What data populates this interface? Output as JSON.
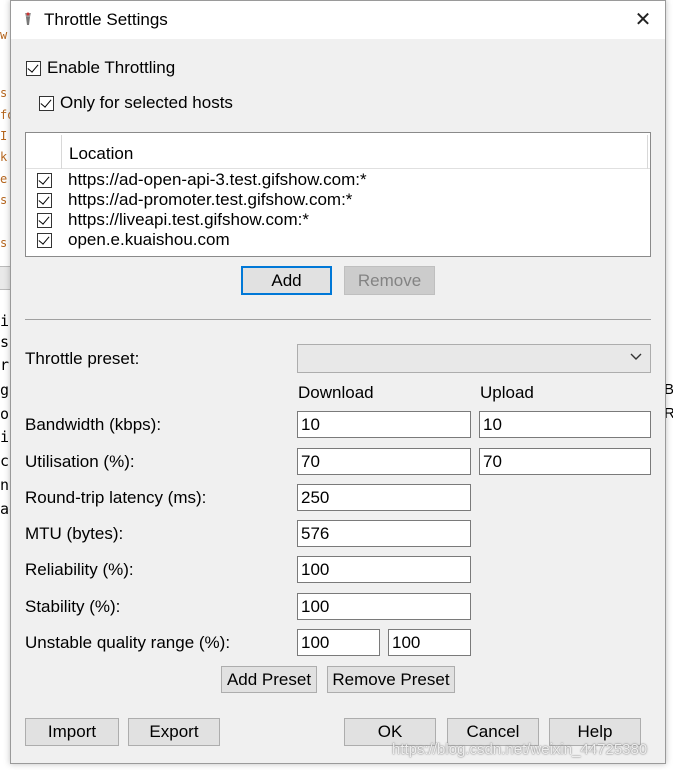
{
  "background": {
    "left_chars": [
      "w",
      "s:",
      "fo",
      "I",
      "k",
      "e",
      "s",
      "s",
      "ic",
      "su",
      "ro",
      "gi",
      "oc",
      "ip",
      "ct",
      "nt",
      "ag"
    ],
    "right_chars": [
      "B",
      "R"
    ]
  },
  "dialog": {
    "title": "Throttle Settings",
    "close_glyph": "✕",
    "enable_throttling": {
      "label": "Enable Throttling",
      "checked": true
    },
    "only_selected_hosts": {
      "label": "Only for selected hosts",
      "checked": true
    },
    "hosts_table": {
      "column_header": "Location",
      "rows": [
        {
          "checked": true,
          "location": "https://ad-open-api-3.test.gifshow.com:*"
        },
        {
          "checked": true,
          "location": "https://ad-promoter.test.gifshow.com:*"
        },
        {
          "checked": true,
          "location": "https://liveapi.test.gifshow.com:*"
        },
        {
          "checked": true,
          "location": "open.e.kuaishou.com"
        }
      ]
    },
    "buttons": {
      "add": "Add",
      "remove": "Remove",
      "add_preset": "Add Preset",
      "remove_preset": "Remove Preset",
      "import": "Import",
      "export": "Export",
      "ok": "OK",
      "cancel": "Cancel",
      "help": "Help"
    },
    "preset": {
      "label": "Throttle preset:",
      "value": "",
      "icon": "chevron-down-icon"
    },
    "columns": {
      "download": "Download",
      "upload": "Upload"
    },
    "fields": {
      "bandwidth": {
        "label": "Bandwidth (kbps):",
        "download": "10",
        "upload": "10"
      },
      "utilisation": {
        "label": "Utilisation (%):",
        "download": "70",
        "upload": "70"
      },
      "latency": {
        "label": "Round-trip latency (ms):",
        "value": "250"
      },
      "mtu": {
        "label": "MTU (bytes):",
        "value": "576"
      },
      "reliability": {
        "label": "Reliability (%):",
        "value": "100"
      },
      "stability": {
        "label": "Stability (%):",
        "value": "100"
      },
      "unstable_range": {
        "label": "Unstable quality range (%):",
        "min": "100",
        "max": "100"
      }
    },
    "watermark": "https://blog.csdn.net/weixin_44725380"
  }
}
